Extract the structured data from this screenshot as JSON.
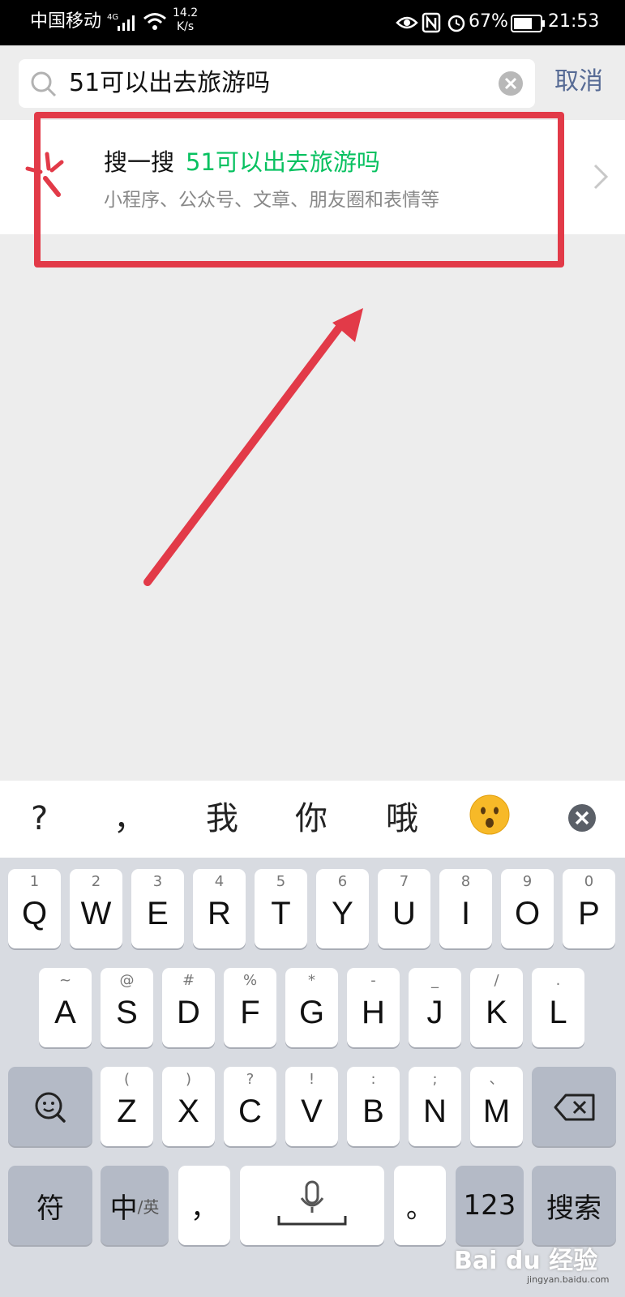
{
  "status_bar": {
    "carrier": "中国移动",
    "network": "4G",
    "speed_value": "14.2",
    "speed_unit": "K/s",
    "battery": "67%",
    "time": "21:53"
  },
  "search": {
    "query": "51可以出去旅游吗",
    "cancel_label": "取消"
  },
  "result": {
    "prefix": "搜一搜",
    "query_highlight": "51可以出去旅游吗",
    "subtitle": "小程序、公众号、文章、朋友圈和表情等"
  },
  "candidates": [
    "?",
    "，",
    "我",
    "你",
    "哦"
  ],
  "keyboard": {
    "row1": [
      {
        "key": "Q",
        "sec": "1"
      },
      {
        "key": "W",
        "sec": "2"
      },
      {
        "key": "E",
        "sec": "3"
      },
      {
        "key": "R",
        "sec": "4"
      },
      {
        "key": "T",
        "sec": "5"
      },
      {
        "key": "Y",
        "sec": "6"
      },
      {
        "key": "U",
        "sec": "7"
      },
      {
        "key": "I",
        "sec": "8"
      },
      {
        "key": "O",
        "sec": "9"
      },
      {
        "key": "P",
        "sec": "0"
      }
    ],
    "row2": [
      {
        "key": "A",
        "sec": "~"
      },
      {
        "key": "S",
        "sec": "@"
      },
      {
        "key": "D",
        "sec": "#"
      },
      {
        "key": "F",
        "sec": "%"
      },
      {
        "key": "G",
        "sec": "*"
      },
      {
        "key": "H",
        "sec": "-"
      },
      {
        "key": "J",
        "sec": "_"
      },
      {
        "key": "K",
        "sec": "/"
      },
      {
        "key": "L",
        "sec": "."
      }
    ],
    "row3": [
      {
        "key": "Z",
        "sec": "("
      },
      {
        "key": "X",
        "sec": ")"
      },
      {
        "key": "C",
        "sec": "?"
      },
      {
        "key": "V",
        "sec": "!"
      },
      {
        "key": "B",
        "sec": ":"
      },
      {
        "key": "N",
        "sec": ";"
      },
      {
        "key": "M",
        "sec": "、"
      }
    ],
    "symbol_label": "符",
    "lang_main": "中",
    "lang_alt": "/英",
    "comma": "，",
    "period": "。",
    "num_label": "123",
    "search_label": "搜索"
  },
  "watermark": {
    "logo": "Bai du 经验",
    "site": "jingyan.baidu.com"
  },
  "colors": {
    "accent_green": "#07c160",
    "link_blue": "#576b95",
    "annotation_red": "#e23a48"
  }
}
